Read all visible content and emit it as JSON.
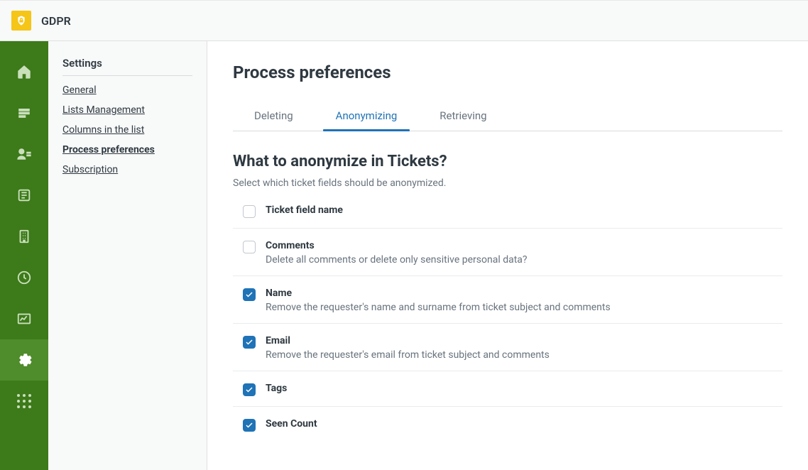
{
  "app": {
    "title": "GDPR"
  },
  "rail": {
    "items": [
      {
        "name": "home-icon"
      },
      {
        "name": "list-icon"
      },
      {
        "name": "agent-icon"
      },
      {
        "name": "ticket-icon"
      },
      {
        "name": "org-icon"
      },
      {
        "name": "clock-icon"
      },
      {
        "name": "analytics-icon"
      },
      {
        "name": "gear-icon",
        "active": true
      },
      {
        "name": "apps-icon"
      }
    ]
  },
  "settings": {
    "title": "Settings",
    "items": [
      {
        "label": "General"
      },
      {
        "label": "Lists Management"
      },
      {
        "label": "Columns in the list"
      },
      {
        "label": "Process preferences",
        "current": true
      },
      {
        "label": "Subscription"
      }
    ]
  },
  "page": {
    "title": "Process preferences",
    "tabs": [
      {
        "label": "Deleting"
      },
      {
        "label": "Anonymizing",
        "active": true
      },
      {
        "label": "Retrieving"
      }
    ],
    "section": {
      "title": "What to anonymize in Tickets?",
      "description": "Select which ticket fields should be anonymized."
    },
    "fields": [
      {
        "label": "Ticket field name",
        "sub": "",
        "checked": false
      },
      {
        "label": "Comments",
        "sub": "Delete all comments or delete only sensitive personal data?",
        "checked": false
      },
      {
        "label": "Name",
        "sub": "Remove the requester's name and surname from ticket subject and comments",
        "checked": true
      },
      {
        "label": "Email",
        "sub": "Remove the requester's email from ticket subject and comments",
        "checked": true
      },
      {
        "label": "Tags",
        "sub": "",
        "checked": true
      },
      {
        "label": "Seen Count",
        "sub": "",
        "checked": true
      }
    ]
  }
}
